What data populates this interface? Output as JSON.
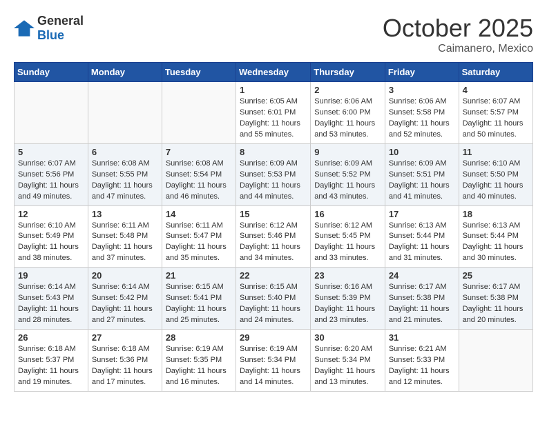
{
  "header": {
    "logo": {
      "general": "General",
      "blue": "Blue"
    },
    "title": "October 2025",
    "location": "Caimanero, Mexico"
  },
  "weekdays": [
    "Sunday",
    "Monday",
    "Tuesday",
    "Wednesday",
    "Thursday",
    "Friday",
    "Saturday"
  ],
  "weeks": [
    [
      {
        "day": "",
        "info": ""
      },
      {
        "day": "",
        "info": ""
      },
      {
        "day": "",
        "info": ""
      },
      {
        "day": "1",
        "info": "Sunrise: 6:05 AM\nSunset: 6:01 PM\nDaylight: 11 hours and 55 minutes."
      },
      {
        "day": "2",
        "info": "Sunrise: 6:06 AM\nSunset: 6:00 PM\nDaylight: 11 hours and 53 minutes."
      },
      {
        "day": "3",
        "info": "Sunrise: 6:06 AM\nSunset: 5:58 PM\nDaylight: 11 hours and 52 minutes."
      },
      {
        "day": "4",
        "info": "Sunrise: 6:07 AM\nSunset: 5:57 PM\nDaylight: 11 hours and 50 minutes."
      }
    ],
    [
      {
        "day": "5",
        "info": "Sunrise: 6:07 AM\nSunset: 5:56 PM\nDaylight: 11 hours and 49 minutes."
      },
      {
        "day": "6",
        "info": "Sunrise: 6:08 AM\nSunset: 5:55 PM\nDaylight: 11 hours and 47 minutes."
      },
      {
        "day": "7",
        "info": "Sunrise: 6:08 AM\nSunset: 5:54 PM\nDaylight: 11 hours and 46 minutes."
      },
      {
        "day": "8",
        "info": "Sunrise: 6:09 AM\nSunset: 5:53 PM\nDaylight: 11 hours and 44 minutes."
      },
      {
        "day": "9",
        "info": "Sunrise: 6:09 AM\nSunset: 5:52 PM\nDaylight: 11 hours and 43 minutes."
      },
      {
        "day": "10",
        "info": "Sunrise: 6:09 AM\nSunset: 5:51 PM\nDaylight: 11 hours and 41 minutes."
      },
      {
        "day": "11",
        "info": "Sunrise: 6:10 AM\nSunset: 5:50 PM\nDaylight: 11 hours and 40 minutes."
      }
    ],
    [
      {
        "day": "12",
        "info": "Sunrise: 6:10 AM\nSunset: 5:49 PM\nDaylight: 11 hours and 38 minutes."
      },
      {
        "day": "13",
        "info": "Sunrise: 6:11 AM\nSunset: 5:48 PM\nDaylight: 11 hours and 37 minutes."
      },
      {
        "day": "14",
        "info": "Sunrise: 6:11 AM\nSunset: 5:47 PM\nDaylight: 11 hours and 35 minutes."
      },
      {
        "day": "15",
        "info": "Sunrise: 6:12 AM\nSunset: 5:46 PM\nDaylight: 11 hours and 34 minutes."
      },
      {
        "day": "16",
        "info": "Sunrise: 6:12 AM\nSunset: 5:45 PM\nDaylight: 11 hours and 33 minutes."
      },
      {
        "day": "17",
        "info": "Sunrise: 6:13 AM\nSunset: 5:44 PM\nDaylight: 11 hours and 31 minutes."
      },
      {
        "day": "18",
        "info": "Sunrise: 6:13 AM\nSunset: 5:44 PM\nDaylight: 11 hours and 30 minutes."
      }
    ],
    [
      {
        "day": "19",
        "info": "Sunrise: 6:14 AM\nSunset: 5:43 PM\nDaylight: 11 hours and 28 minutes."
      },
      {
        "day": "20",
        "info": "Sunrise: 6:14 AM\nSunset: 5:42 PM\nDaylight: 11 hours and 27 minutes."
      },
      {
        "day": "21",
        "info": "Sunrise: 6:15 AM\nSunset: 5:41 PM\nDaylight: 11 hours and 25 minutes."
      },
      {
        "day": "22",
        "info": "Sunrise: 6:15 AM\nSunset: 5:40 PM\nDaylight: 11 hours and 24 minutes."
      },
      {
        "day": "23",
        "info": "Sunrise: 6:16 AM\nSunset: 5:39 PM\nDaylight: 11 hours and 23 minutes."
      },
      {
        "day": "24",
        "info": "Sunrise: 6:17 AM\nSunset: 5:38 PM\nDaylight: 11 hours and 21 minutes."
      },
      {
        "day": "25",
        "info": "Sunrise: 6:17 AM\nSunset: 5:38 PM\nDaylight: 11 hours and 20 minutes."
      }
    ],
    [
      {
        "day": "26",
        "info": "Sunrise: 6:18 AM\nSunset: 5:37 PM\nDaylight: 11 hours and 19 minutes."
      },
      {
        "day": "27",
        "info": "Sunrise: 6:18 AM\nSunset: 5:36 PM\nDaylight: 11 hours and 17 minutes."
      },
      {
        "day": "28",
        "info": "Sunrise: 6:19 AM\nSunset: 5:35 PM\nDaylight: 11 hours and 16 minutes."
      },
      {
        "day": "29",
        "info": "Sunrise: 6:19 AM\nSunset: 5:34 PM\nDaylight: 11 hours and 14 minutes."
      },
      {
        "day": "30",
        "info": "Sunrise: 6:20 AM\nSunset: 5:34 PM\nDaylight: 11 hours and 13 minutes."
      },
      {
        "day": "31",
        "info": "Sunrise: 6:21 AM\nSunset: 5:33 PM\nDaylight: 11 hours and 12 minutes."
      },
      {
        "day": "",
        "info": ""
      }
    ]
  ]
}
